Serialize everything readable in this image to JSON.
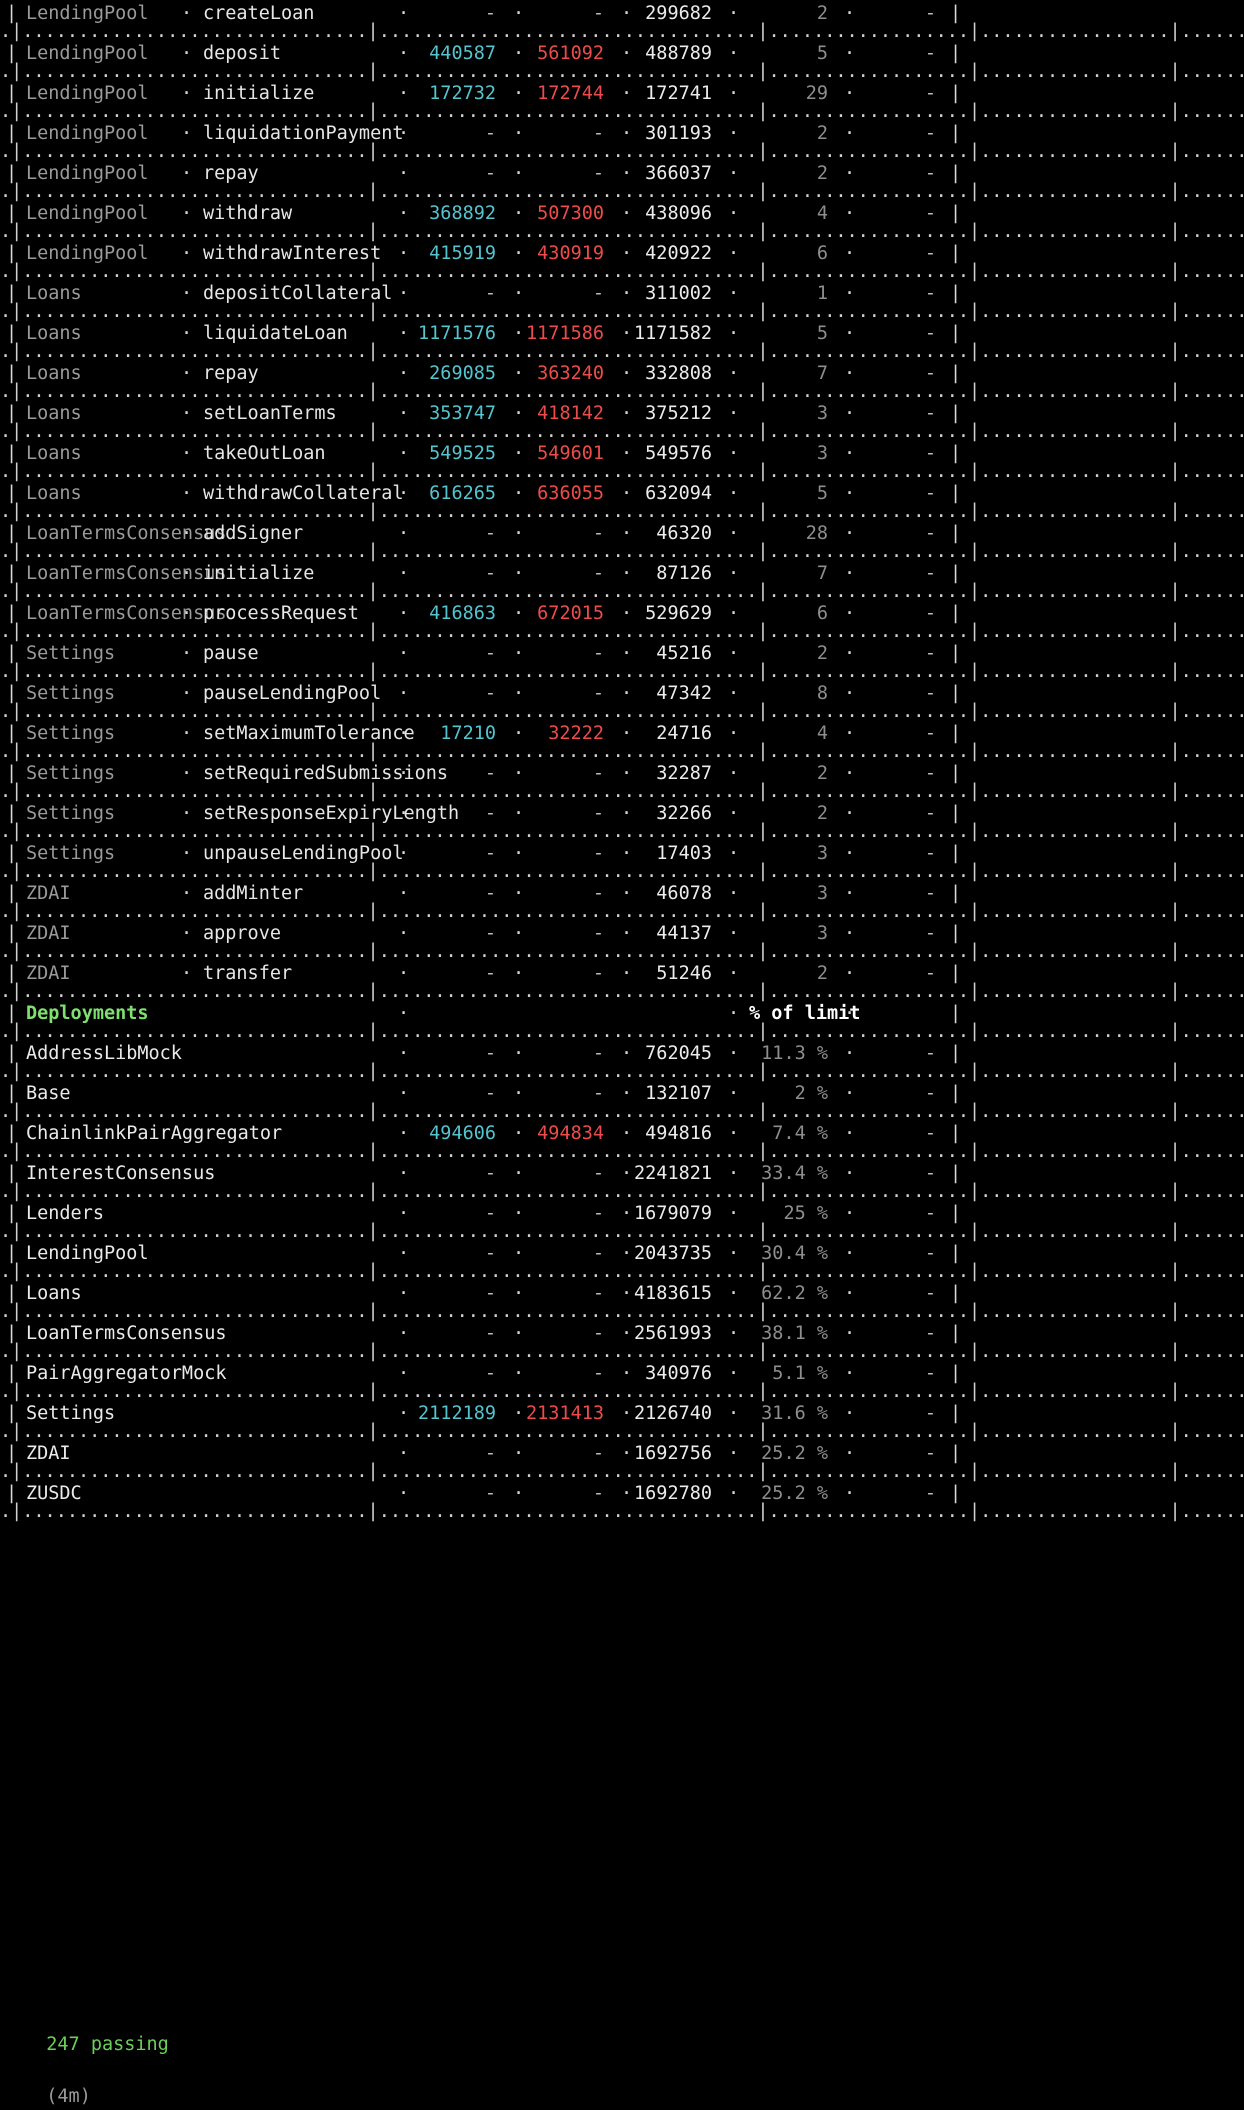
{
  "methods": [
    {
      "contract": "LendingPool",
      "method": "createLoan",
      "min": "-",
      "max": "-",
      "avg": "299682",
      "calls": "2",
      "eur": "-"
    },
    {
      "contract": "LendingPool",
      "method": "deposit",
      "min": "440587",
      "max": "561092",
      "avg": "488789",
      "calls": "5",
      "eur": "-"
    },
    {
      "contract": "LendingPool",
      "method": "initialize",
      "min": "172732",
      "max": "172744",
      "avg": "172741",
      "calls": "29",
      "eur": "-"
    },
    {
      "contract": "LendingPool",
      "method": "liquidationPayment",
      "min": "-",
      "max": "-",
      "avg": "301193",
      "calls": "2",
      "eur": "-"
    },
    {
      "contract": "LendingPool",
      "method": "repay",
      "min": "-",
      "max": "-",
      "avg": "366037",
      "calls": "2",
      "eur": "-"
    },
    {
      "contract": "LendingPool",
      "method": "withdraw",
      "min": "368892",
      "max": "507300",
      "avg": "438096",
      "calls": "4",
      "eur": "-"
    },
    {
      "contract": "LendingPool",
      "method": "withdrawInterest",
      "min": "415919",
      "max": "430919",
      "avg": "420922",
      "calls": "6",
      "eur": "-"
    },
    {
      "contract": "Loans",
      "method": "depositCollateral",
      "min": "-",
      "max": "-",
      "avg": "311002",
      "calls": "1",
      "eur": "-"
    },
    {
      "contract": "Loans",
      "method": "liquidateLoan",
      "min": "1171576",
      "max": "1171586",
      "avg": "1171582",
      "calls": "5",
      "eur": "-"
    },
    {
      "contract": "Loans",
      "method": "repay",
      "min": "269085",
      "max": "363240",
      "avg": "332808",
      "calls": "7",
      "eur": "-"
    },
    {
      "contract": "Loans",
      "method": "setLoanTerms",
      "min": "353747",
      "max": "418142",
      "avg": "375212",
      "calls": "3",
      "eur": "-"
    },
    {
      "contract": "Loans",
      "method": "takeOutLoan",
      "min": "549525",
      "max": "549601",
      "avg": "549576",
      "calls": "3",
      "eur": "-"
    },
    {
      "contract": "Loans",
      "method": "withdrawCollateral",
      "min": "616265",
      "max": "636055",
      "avg": "632094",
      "calls": "5",
      "eur": "-"
    },
    {
      "contract": "LoanTermsConsensus",
      "method": "addSigner",
      "min": "-",
      "max": "-",
      "avg": "46320",
      "calls": "28",
      "eur": "-"
    },
    {
      "contract": "LoanTermsConsensus",
      "method": "initialize",
      "min": "-",
      "max": "-",
      "avg": "87126",
      "calls": "7",
      "eur": "-"
    },
    {
      "contract": "LoanTermsConsensus",
      "method": "processRequest",
      "min": "416863",
      "max": "672015",
      "avg": "529629",
      "calls": "6",
      "eur": "-"
    },
    {
      "contract": "Settings",
      "method": "pause",
      "min": "-",
      "max": "-",
      "avg": "45216",
      "calls": "2",
      "eur": "-"
    },
    {
      "contract": "Settings",
      "method": "pauseLendingPool",
      "min": "-",
      "max": "-",
      "avg": "47342",
      "calls": "8",
      "eur": "-"
    },
    {
      "contract": "Settings",
      "method": "setMaximumTolerance",
      "min": "17210",
      "max": "32222",
      "avg": "24716",
      "calls": "4",
      "eur": "-"
    },
    {
      "contract": "Settings",
      "method": "setRequiredSubmissions",
      "min": "-",
      "max": "-",
      "avg": "32287",
      "calls": "2",
      "eur": "-"
    },
    {
      "contract": "Settings",
      "method": "setResponseExpiryLength",
      "min": "-",
      "max": "-",
      "avg": "32266",
      "calls": "2",
      "eur": "-"
    },
    {
      "contract": "Settings",
      "method": "unpauseLendingPool",
      "min": "-",
      "max": "-",
      "avg": "17403",
      "calls": "3",
      "eur": "-"
    },
    {
      "contract": "ZDAI",
      "method": "addMinter",
      "min": "-",
      "max": "-",
      "avg": "46078",
      "calls": "3",
      "eur": "-"
    },
    {
      "contract": "ZDAI",
      "method": "approve",
      "min": "-",
      "max": "-",
      "avg": "44137",
      "calls": "3",
      "eur": "-"
    },
    {
      "contract": "ZDAI",
      "method": "transfer",
      "min": "-",
      "max": "-",
      "avg": "51246",
      "calls": "2",
      "eur": "-"
    }
  ],
  "deployments_header": {
    "title": "Deployments",
    "percent_label": "% of limit"
  },
  "deployments": [
    {
      "contract": "AddressLibMock",
      "min": "-",
      "max": "-",
      "avg": "762045",
      "pct": "11.3 %",
      "eur": "-"
    },
    {
      "contract": "Base",
      "min": "-",
      "max": "-",
      "avg": "132107",
      "pct": "2 %",
      "eur": "-"
    },
    {
      "contract": "ChainlinkPairAggregator",
      "min": "494606",
      "max": "494834",
      "avg": "494816",
      "pct": "7.4 %",
      "eur": "-"
    },
    {
      "contract": "InterestConsensus",
      "min": "-",
      "max": "-",
      "avg": "2241821",
      "pct": "33.4 %",
      "eur": "-"
    },
    {
      "contract": "Lenders",
      "min": "-",
      "max": "-",
      "avg": "1679079",
      "pct": "25 %",
      "eur": "-"
    },
    {
      "contract": "LendingPool",
      "min": "-",
      "max": "-",
      "avg": "2043735",
      "pct": "30.4 %",
      "eur": "-"
    },
    {
      "contract": "Loans",
      "min": "-",
      "max": "-",
      "avg": "4183615",
      "pct": "62.2 %",
      "eur": "-"
    },
    {
      "contract": "LoanTermsConsensus",
      "min": "-",
      "max": "-",
      "avg": "2561993",
      "pct": "38.1 %",
      "eur": "-"
    },
    {
      "contract": "PairAggregatorMock",
      "min": "-",
      "max": "-",
      "avg": "340976",
      "pct": "5.1 %",
      "eur": "-"
    },
    {
      "contract": "Settings",
      "min": "2112189",
      "max": "2131413",
      "avg": "2126740",
      "pct": "31.6 %",
      "eur": "-"
    },
    {
      "contract": "ZDAI",
      "min": "-",
      "max": "-",
      "avg": "1692756",
      "pct": "25.2 %",
      "eur": "-"
    },
    {
      "contract": "ZUSDC",
      "min": "-",
      "max": "-",
      "avg": "1692780",
      "pct": "25.2 %",
      "eur": "-"
    }
  ],
  "status": {
    "passing": "247 passing",
    "duration": "(4m)"
  },
  "colors": {
    "min": "#54c4cf",
    "max": "#ee4b4b",
    "header": "#7ee06f",
    "passing": "#6ccf5a"
  }
}
